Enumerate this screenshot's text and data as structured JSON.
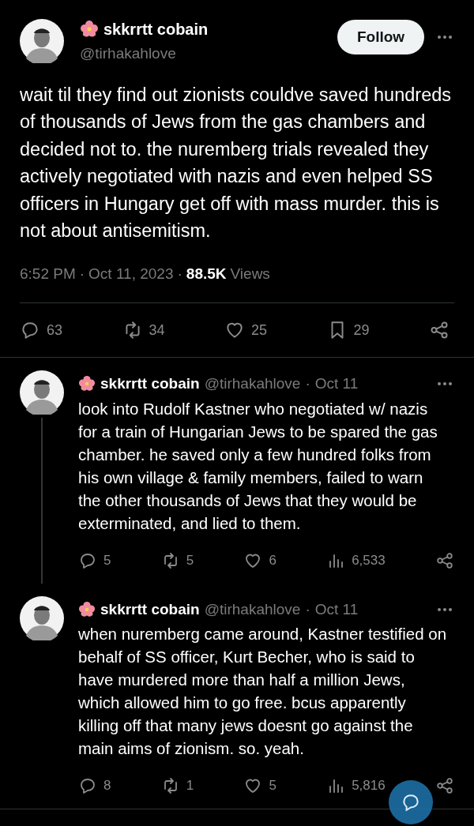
{
  "main_post": {
    "author": {
      "name": "skkrrtt cobain",
      "handle": "@tirhakahlove"
    },
    "follow_button": "Follow",
    "text": "wait til they find out zionists couldve saved hundreds of thousands of Jews from the gas chambers and decided not to. the nuremberg trials revealed they actively negotiated with nazis and even helped SS officers in Hungary get off with mass murder. this is not about antisemitism.",
    "time": "6:52 PM",
    "separator": "·",
    "date": "Oct 11, 2023",
    "views": "88.5K",
    "separator_2": "·",
    "views_label": "Views",
    "stats": {
      "replies": "63",
      "reposts": "34",
      "likes": "25",
      "bookmarks": "29"
    }
  },
  "replies": [
    {
      "author": {
        "name": "skkrrtt cobain",
        "handle": "@tirhakahlove"
      },
      "separator": "·",
      "date": "Oct 11",
      "thread_line": true,
      "text": "look into Rudolf Kastner who negotiated w/ nazis for a train of Hungarian Jews to be spared the gas chamber. he saved only a few hundred folks from his own village & family members, failed to warn the other thousands of Jews that they would be exterminated, and lied to them.",
      "stats": {
        "replies": "5",
        "reposts": "5",
        "likes": "6",
        "views": "6,533"
      }
    },
    {
      "author": {
        "name": "skkrrtt cobain",
        "handle": "@tirhakahlove"
      },
      "separator": "·",
      "date": "Oct 11",
      "thread_line": false,
      "text": "when nuremberg came around, Kastner testified on behalf of SS officer, Kurt Becher, who is said to have murdered more than half a million Jews, which allowed him to go free. bcus apparently killing off that many jews doesnt go against the main aims of zionism. so. yeah.",
      "stats": {
        "replies": "8",
        "reposts": "1",
        "likes": "5",
        "views": "5,816"
      }
    }
  ]
}
